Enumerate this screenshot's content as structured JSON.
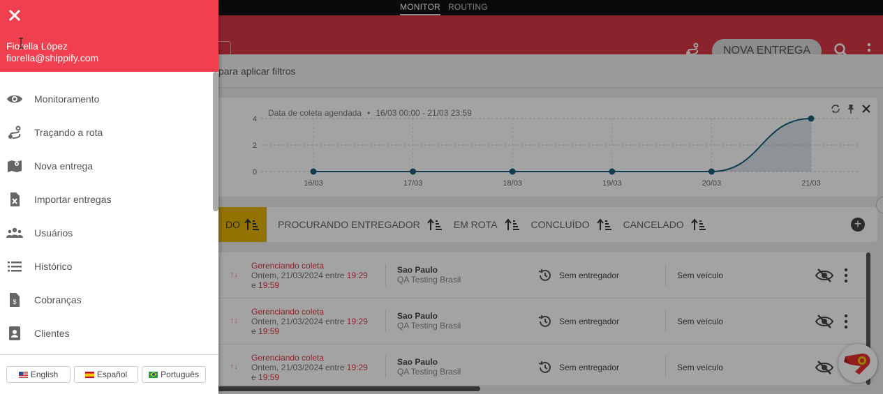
{
  "top_tabs": {
    "monitor": "MONITOR",
    "routing": "ROUTING"
  },
  "header": {
    "new_delivery_button": "NOVA ENTREGA"
  },
  "filter_bar": {
    "hint": "para aplicar filtros"
  },
  "chart_card": {
    "label": "Data de coleta agendada",
    "range": "16/03 00:00 - 21/03 23:59"
  },
  "chart_data": {
    "type": "area",
    "categories": [
      "16/03",
      "17/03",
      "18/03",
      "19/03",
      "20/03",
      "21/03"
    ],
    "values": [
      0,
      0,
      0,
      0,
      0,
      4
    ],
    "y_ticks": [
      "0",
      "2",
      "4"
    ],
    "ylim": [
      0,
      4
    ],
    "grid": true
  },
  "status_tabs": {
    "active_fragment": "DO",
    "items": [
      "PROCURANDO ENTREGADOR",
      "EM ROTA",
      "CONCLUÍDO",
      "CANCELADO"
    ]
  },
  "rows": [
    {
      "status": "Gerenciando coleta",
      "date_prefix": "Ontem, 21/03/2024 entre",
      "time_start": "19:29",
      "e": "e",
      "time_end": "19:59",
      "city": "Sao Paulo",
      "team": "QA Testing Brasil",
      "driver": "Sem entregador",
      "vehicle": "Sem veículo"
    },
    {
      "status": "Gerenciando coleta",
      "date_prefix": "Ontem, 21/03/2024 entre",
      "time_start": "19:29",
      "e": "e",
      "time_end": "19:59",
      "city": "Sao Paulo",
      "team": "QA Testing Brasil",
      "driver": "Sem entregador",
      "vehicle": "Sem veículo"
    },
    {
      "status": "Gerenciando coleta",
      "date_prefix": "Ontem, 21/03/2024 entre",
      "time_start": "19:29",
      "e": "e",
      "time_end": "19:59",
      "city": "Sao Paulo",
      "team": "QA Testing Brasil",
      "driver": "Sem entregador",
      "vehicle": "Sem veículo"
    }
  ],
  "drawer": {
    "user_name": "Fiorella López",
    "user_email": "fiorella@shippify.com",
    "menu": [
      {
        "label": "Monitoramento",
        "icon": "eye-icon"
      },
      {
        "label": "Traçando a rota",
        "icon": "route-icon"
      },
      {
        "label": "Nova entrega",
        "icon": "map-icon"
      },
      {
        "label": "Importar entregas",
        "icon": "excel-file-icon"
      },
      {
        "label": "Usuários",
        "icon": "users-icon"
      },
      {
        "label": "Histórico",
        "icon": "list-icon"
      },
      {
        "label": "Cobranças",
        "icon": "invoice-icon"
      },
      {
        "label": "Clientes",
        "icon": "contact-book-icon"
      }
    ],
    "languages": {
      "english": "English",
      "spanish": "Español",
      "portuguese": "Português"
    }
  },
  "colors": {
    "brand_red": "#f0404f",
    "chart_line": "#1a5f7a",
    "accent_teal": "#0e7fa0"
  }
}
